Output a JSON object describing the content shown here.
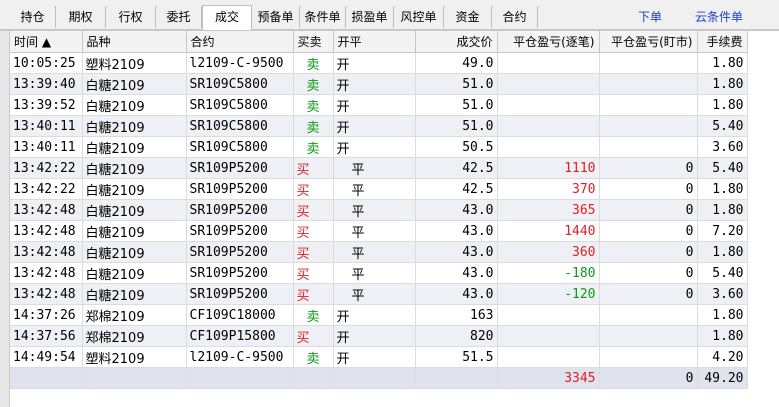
{
  "tabs": [
    "持仓",
    "期权",
    "行权",
    "委托",
    "成交",
    "预备单",
    "条件单",
    "损盈单",
    "风控单",
    "资金",
    "合约"
  ],
  "active_tab": "成交",
  "links": [
    "下单",
    "云条件单"
  ],
  "columns": [
    "时间 ▲",
    "品种",
    "合约",
    "买卖",
    "开平",
    "成交价",
    "平仓盈亏(逐笔)",
    "平仓盈亏(盯市)",
    "手续费"
  ],
  "rows": [
    {
      "time": "10:05:25",
      "variety": "塑料2109",
      "contract": "l2109-C-9500",
      "side": "卖",
      "oc": "开",
      "price": "49.0",
      "pnl_trade": "",
      "pnl_mkt": "",
      "fee": "1.80"
    },
    {
      "time": "13:39:40",
      "variety": "白糖2109",
      "contract": "SR109C5800",
      "side": "卖",
      "oc": "开",
      "price": "51.0",
      "pnl_trade": "",
      "pnl_mkt": "",
      "fee": "1.80"
    },
    {
      "time": "13:39:52",
      "variety": "白糖2109",
      "contract": "SR109C5800",
      "side": "卖",
      "oc": "开",
      "price": "51.0",
      "pnl_trade": "",
      "pnl_mkt": "",
      "fee": "1.80"
    },
    {
      "time": "13:40:11",
      "variety": "白糖2109",
      "contract": "SR109C5800",
      "side": "卖",
      "oc": "开",
      "price": "51.0",
      "pnl_trade": "",
      "pnl_mkt": "",
      "fee": "5.40"
    },
    {
      "time": "13:40:11",
      "variety": "白糖2109",
      "contract": "SR109C5800",
      "side": "卖",
      "oc": "开",
      "price": "50.5",
      "pnl_trade": "",
      "pnl_mkt": "",
      "fee": "3.60"
    },
    {
      "time": "13:42:22",
      "variety": "白糖2109",
      "contract": "SR109P5200",
      "side": "买",
      "oc": "平",
      "price": "42.5",
      "pnl_trade": "1110",
      "pnl_mkt": "0",
      "fee": "5.40"
    },
    {
      "time": "13:42:22",
      "variety": "白糖2109",
      "contract": "SR109P5200",
      "side": "买",
      "oc": "平",
      "price": "42.5",
      "pnl_trade": "370",
      "pnl_mkt": "0",
      "fee": "1.80"
    },
    {
      "time": "13:42:48",
      "variety": "白糖2109",
      "contract": "SR109P5200",
      "side": "买",
      "oc": "平",
      "price": "43.0",
      "pnl_trade": "365",
      "pnl_mkt": "0",
      "fee": "1.80"
    },
    {
      "time": "13:42:48",
      "variety": "白糖2109",
      "contract": "SR109P5200",
      "side": "买",
      "oc": "平",
      "price": "43.0",
      "pnl_trade": "1440",
      "pnl_mkt": "0",
      "fee": "7.20"
    },
    {
      "time": "13:42:48",
      "variety": "白糖2109",
      "contract": "SR109P5200",
      "side": "买",
      "oc": "平",
      "price": "43.0",
      "pnl_trade": "360",
      "pnl_mkt": "0",
      "fee": "1.80"
    },
    {
      "time": "13:42:48",
      "variety": "白糖2109",
      "contract": "SR109P5200",
      "side": "买",
      "oc": "平",
      "price": "43.0",
      "pnl_trade": "-180",
      "pnl_mkt": "0",
      "fee": "5.40"
    },
    {
      "time": "13:42:48",
      "variety": "白糖2109",
      "contract": "SR109P5200",
      "side": "买",
      "oc": "平",
      "price": "43.0",
      "pnl_trade": "-120",
      "pnl_mkt": "0",
      "fee": "3.60"
    },
    {
      "time": "14:37:26",
      "variety": "郑棉2109",
      "contract": "CF109C18000",
      "side": "卖",
      "oc": "开",
      "price": "163",
      "pnl_trade": "",
      "pnl_mkt": "",
      "fee": "1.80"
    },
    {
      "time": "14:37:56",
      "variety": "郑棉2109",
      "contract": "CF109P15800",
      "side": "买",
      "oc": "开",
      "price": "820",
      "pnl_trade": "",
      "pnl_mkt": "",
      "fee": "1.80"
    },
    {
      "time": "14:49:54",
      "variety": "塑料2109",
      "contract": "l2109-C-9500",
      "side": "卖",
      "oc": "开",
      "price": "51.5",
      "pnl_trade": "",
      "pnl_mkt": "",
      "fee": "4.20"
    }
  ],
  "totals": {
    "pnl_trade": "3345",
    "pnl_mkt": "0",
    "fee": "49.20"
  },
  "colors": {
    "buy": "#e02020",
    "sell": "#0a9a18",
    "link": "#1a3fd8"
  }
}
